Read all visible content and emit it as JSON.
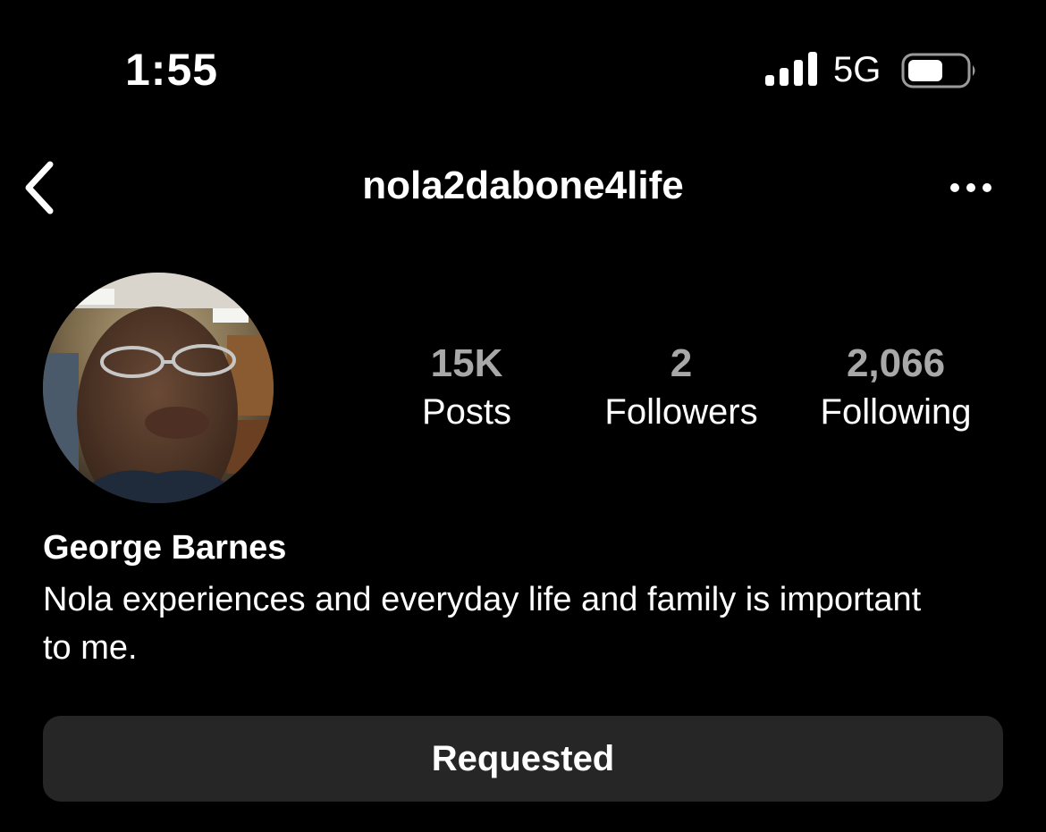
{
  "status_bar": {
    "time": "1:55",
    "network": "5G",
    "signal_icon": "cellular-signal-icon",
    "battery_icon": "battery-icon"
  },
  "nav": {
    "username": "nola2dabone4life",
    "back_icon": "chevron-left-icon",
    "more_icon": "more-horizontal-icon"
  },
  "profile": {
    "name": "George Barnes",
    "bio": "Nola experiences and everyday life and family is important to me.",
    "avatar": "profile-photo"
  },
  "stats": [
    {
      "value": "15K",
      "label": "Posts"
    },
    {
      "value": "2",
      "label": "Followers"
    },
    {
      "value": "2,066",
      "label": "Following"
    }
  ],
  "actions": {
    "follow_button_label": "Requested"
  },
  "colors": {
    "background": "#000000",
    "text": "#ffffff",
    "stat_value": "#a8a8a8",
    "button_bg": "#262626"
  }
}
